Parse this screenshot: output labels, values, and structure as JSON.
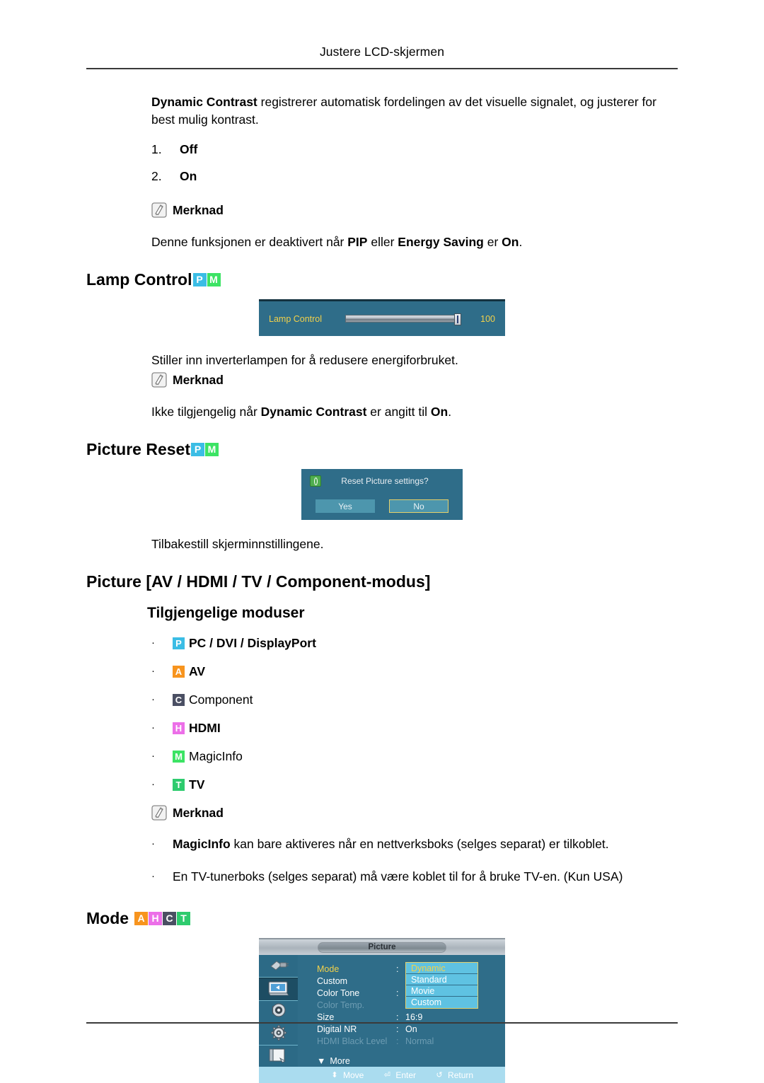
{
  "page": {
    "running_head": "Justere LCD-skjermen"
  },
  "dynamic_contrast": {
    "paragraph_bold": "Dynamic Contrast",
    "paragraph_rest": " registrerer automatisk fordelingen av det visuelle signalet, og justerer for best mulig kontrast.",
    "options": [
      {
        "num": "1.",
        "label": "Off"
      },
      {
        "num": "2.",
        "label": "On"
      }
    ],
    "note_label": "Merknad",
    "note_text_1": "Denne funksjonen er deaktivert når ",
    "note_bold_1": "PIP",
    "note_text_2": " eller ",
    "note_bold_2": "Energy Saving",
    "note_text_3": " er ",
    "note_bold_3": "On",
    "note_text_4": "."
  },
  "lamp_control": {
    "heading": "Lamp Control",
    "badges": [
      {
        "letter": "P",
        "color": "#3bbde5"
      },
      {
        "letter": "M",
        "color": "#3ce364"
      }
    ],
    "osd": {
      "label": "Lamp Control",
      "value": "100",
      "slider_percent": 100
    },
    "description": "Stiller inn inverterlampen for å redusere energiforbruket.",
    "note_label": "Merknad",
    "note_text_1": "Ikke tilgjengelig når ",
    "note_bold_1": "Dynamic Contrast",
    "note_text_2": " er angitt til ",
    "note_bold_2": "On",
    "note_text_3": "."
  },
  "picture_reset": {
    "heading": "Picture Reset",
    "badges": [
      {
        "letter": "P",
        "color": "#3bbde5"
      },
      {
        "letter": "M",
        "color": "#3ce364"
      }
    ],
    "dialog": {
      "title": "Reset Picture settings?",
      "buttons": [
        {
          "label": "Yes",
          "selected": false
        },
        {
          "label": "No",
          "selected": true
        }
      ]
    },
    "description": "Tilbakestill skjerminnstillingene."
  },
  "picture_section": {
    "heading": "Picture [AV / HDMI / TV / Component-modus]",
    "subheading": "Tilgjengelige moduser",
    "modes": [
      {
        "letter": "P",
        "color": "#3bbde5",
        "label": "PC / DVI / DisplayPort"
      },
      {
        "letter": "A",
        "color": "#f7941e",
        "label": "AV"
      },
      {
        "letter": "C",
        "color": "#4a4f63",
        "label": "Component"
      },
      {
        "letter": "H",
        "color": "#ec6fe8",
        "label": "HDMI"
      },
      {
        "letter": "M",
        "color": "#3ce364",
        "label": "MagicInfo"
      },
      {
        "letter": "T",
        "color": "#2ecb6e",
        "label": "TV"
      }
    ],
    "note_label": "Merknad",
    "note_bullets": [
      {
        "bold": "MagicInfo",
        "rest": " kan bare aktiveres når en nettverksboks (selges separat) er tilkoblet."
      },
      {
        "bold": "",
        "rest": "En TV-tunerboks (selges separat) må være koblet til for å bruke TV-en. (Kun USA)"
      }
    ]
  },
  "mode": {
    "heading": "Mode",
    "badges": [
      {
        "letter": "A",
        "color": "#f7941e"
      },
      {
        "letter": "H",
        "color": "#ec6fe8"
      },
      {
        "letter": "C",
        "color": "#4a4f63"
      },
      {
        "letter": "T",
        "color": "#2ecb6e"
      }
    ],
    "osd": {
      "title": "Picture",
      "sidebar_icons": [
        "input-plug-icon",
        "picture-icon",
        "sound-speaker-icon",
        "setup-gear-icon",
        "multi-control-icon"
      ],
      "rows": [
        {
          "label": "Mode",
          "colon": ":",
          "value": "",
          "state": "selected"
        },
        {
          "label": "Custom",
          "colon": "",
          "value": "",
          "state": "normal"
        },
        {
          "label": "Color Tone",
          "colon": ":",
          "value": "",
          "state": "normal"
        },
        {
          "label": "Color Temp.",
          "colon": "",
          "value": "",
          "state": "disabled"
        },
        {
          "label": "Size",
          "colon": ":",
          "value": "16:9",
          "state": "normal"
        },
        {
          "label": "Digital NR",
          "colon": ":",
          "value": "On",
          "state": "normal"
        },
        {
          "label": "HDMI Black Level",
          "colon": ":",
          "value": "Normal",
          "state": "disabled"
        }
      ],
      "more_label": "More",
      "dropdown": [
        {
          "label": "Dynamic",
          "selected": true
        },
        {
          "label": "Standard",
          "selected": false
        },
        {
          "label": "Movie",
          "selected": false
        },
        {
          "label": "Custom",
          "selected": false
        }
      ],
      "footer": [
        {
          "glyph": "⬍",
          "label": "Move",
          "icon": "move-updown-icon"
        },
        {
          "glyph": "⏎",
          "label": "Enter",
          "icon": "enter-icon"
        },
        {
          "glyph": "↺",
          "label": "Return",
          "icon": "return-icon"
        }
      ]
    }
  }
}
